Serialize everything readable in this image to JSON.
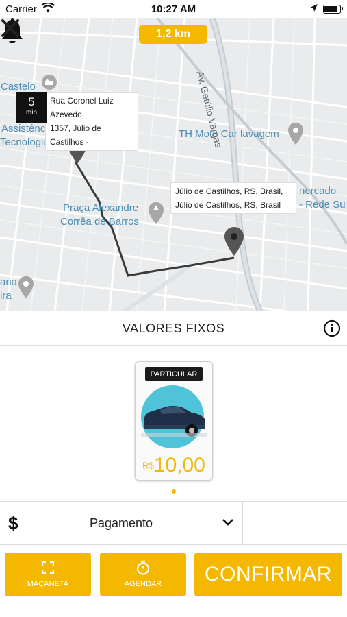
{
  "status_bar": {
    "carrier": "Carrier",
    "time": "10:27 AM"
  },
  "map": {
    "distance": "1,2 km",
    "eta": {
      "value": "5",
      "unit": "min"
    },
    "origin_callout": [
      "Rua Coronel Luiz Azevedo,",
      "1357, Júlio de Castilhos -"
    ],
    "destination_callout": [
      "Júlio de Castilhos, RS, Brasil,",
      "Júlio de Castilhos, RS, Brasil"
    ],
    "street_label": "Av. Getúlio Vargas",
    "places": {
      "castelo": "Castelo",
      "assistencia": "Assistência",
      "tecnologias": "Tecnologias",
      "th_moto": "TH Moto Car lavagem",
      "praca_1": "Praça Alexandre",
      "praca_2": "Corrêa de Barros",
      "mercado": "nercado",
      "rede": "- Rede Su",
      "aria": "aria",
      "ira": "ira"
    }
  },
  "fare_section": {
    "title": "VALORES FIXOS"
  },
  "vehicle": {
    "tag": "PARTICULAR",
    "currency": "R$",
    "price": "10,00"
  },
  "payment": {
    "label": "Pagamento"
  },
  "actions": {
    "macaneta": "MAÇANETA",
    "agendar": "AGENDAR",
    "confirm": "CONFIRMAR"
  },
  "colors": {
    "accent": "#f5b800",
    "map_label": "#4a8fb8"
  }
}
